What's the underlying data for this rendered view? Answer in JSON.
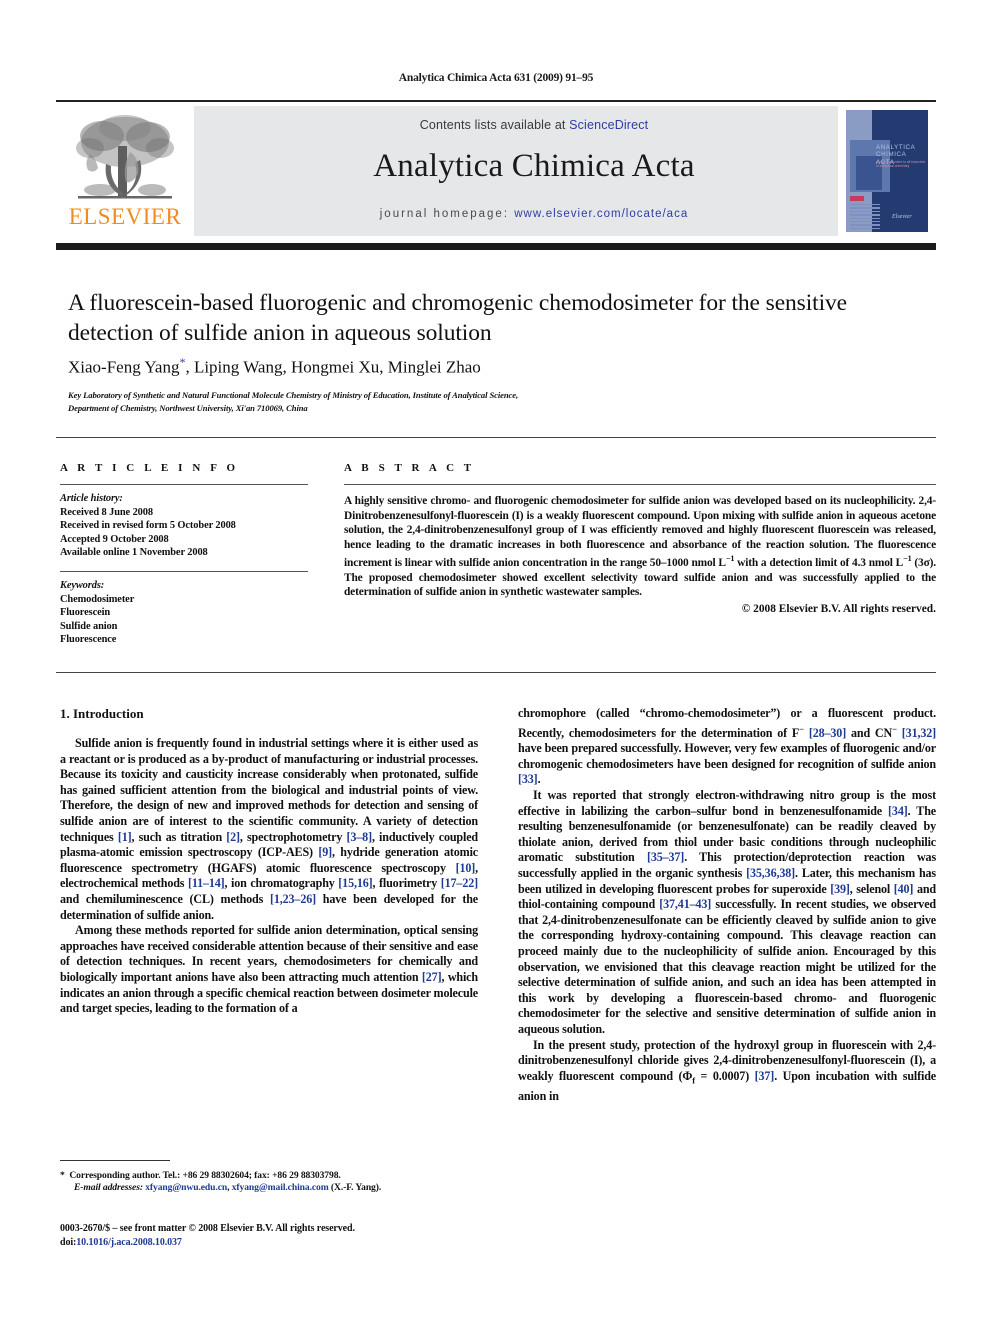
{
  "running_head": "Analytica Chimica Acta 631 (2009) 91–95",
  "masthead": {
    "contents_prefix": "Contents lists available at ",
    "contents_link": "ScienceDirect",
    "journal_title": "Analytica Chimica Acta",
    "homepage_prefix": "journal homepage:",
    "homepage_url": "www.elsevier.com/locate/aca",
    "publisher_logo_text": "ELSEVIER",
    "publisher_logo_color": "#F08C1E",
    "link_color": "#2F3E9E",
    "banner_bg": "#e6e7e9",
    "cover": {
      "title": "ANALYTICA CHIMICA ACTA",
      "subtitle": "A journal devoted to all branches of analytical chemistry",
      "imprint": "Elsevier",
      "bg_color": "#243B72"
    }
  },
  "article": {
    "title": "A fluorescein-based fluorogenic and chromogenic chemodosimeter for the sensitive detection of sulfide anion in aqueous solution",
    "authors": "Xiao-Feng Yang",
    "authors_rest": ", Liping Wang, Hongmei Xu, Minglei Zhao",
    "corresponding_marker": "*",
    "affiliation_line1": "Key Laboratory of Synthetic and Natural Functional Molecule Chemistry of Ministry of Education, Institute of Analytical Science,",
    "affiliation_line2": "Department of Chemistry, Northwest University, Xi'an 710069, China"
  },
  "article_info": {
    "heading": "A R T I C L E    I N F O",
    "history_label": "Article history:",
    "history": [
      "Received 8 June 2008",
      "Received in revised form 5 October 2008",
      "Accepted 9 October 2008",
      "Available online 1 November 2008"
    ],
    "keywords_label": "Keywords:",
    "keywords": [
      "Chemodosimeter",
      "Fluorescein",
      "Sulfide anion",
      "Fluorescence"
    ]
  },
  "abstract": {
    "heading": "A B S T R A C T",
    "part1": "A highly sensitive chromo- and fluorogenic chemodosimeter for sulfide anion was developed based on its nucleophilicity. 2,4-Dinitrobenzenesulfonyl-fluorescein (I) is a weakly fluorescent compound. Upon mixing with sulfide anion in aqueous acetone solution, the 2,4-dinitrobenzenesulfonyl group of I was efficiently removed and highly fluorescent fluorescein was released, hence leading to the dramatic increases in both fluorescence and absorbance of the reaction solution. The fluorescence increment is linear with sulfide anion concentration in the range 50–1000 nmol L",
    "exp1": "−1",
    "part2": " with a detection limit of 4.3 nmol L",
    "exp2": "−1",
    "part3": " (3σ). The proposed chemodosimeter showed excellent selectivity toward sulfide anion and was successfully applied to the determination of sulfide anion in synthetic wastewater samples.",
    "copyright": "© 2008 Elsevier B.V. All rights reserved."
  },
  "body": {
    "section1_heading": "1.  Introduction",
    "left_p1_a": "Sulfide anion is frequently found in industrial settings where it is either used as a reactant or is produced as a by-product of manufacturing or industrial processes. Because its toxicity and causticity increase considerably when protonated, sulfide has gained sufficient attention from the biological and industrial points of view. Therefore, the design of new and improved methods for detection and sensing of sulfide anion are of interest to the scientific community. A variety of detection techniques ",
    "left_p1_r1": "[1]",
    "left_p1_b": ", such as titration ",
    "left_p1_r2": "[2]",
    "left_p1_c": ", spectrophotometry ",
    "left_p1_r3": "[3–8]",
    "left_p1_d": ", inductively coupled plasma-atomic emission spectroscopy (ICP-AES) ",
    "left_p1_r4": "[9]",
    "left_p1_e": ", hydride generation atomic fluorescence spectrometry (HGAFS) atomic fluorescence spectroscopy ",
    "left_p1_r5": "[10]",
    "left_p1_f": ", electrochemical methods ",
    "left_p1_r6": "[11–14]",
    "left_p1_g": ", ion chromatography ",
    "left_p1_r7": "[15,16]",
    "left_p1_h": ", fluorimetry ",
    "left_p1_r8": "[17–22]",
    "left_p1_i": " and chemiluminescence (CL) methods ",
    "left_p1_r9": "[1,23–26]",
    "left_p1_j": " have been developed for the determination of sulfide anion.",
    "left_p2_a": "Among these methods reported for sulfide anion determination, optical sensing approaches have received considerable attention because of their sensitive and ease of detection techniques. In recent years, chemodosimeters for chemically and biologically important anions have also been attracting much attention ",
    "left_p2_r1": "[27]",
    "left_p2_b": ", which indicates an anion through a specific chemical reaction between dosimeter molecule and target species, leading to the formation of a",
    "right_p1_a": "chromophore (called “chromo-chemodosimeter”) or a fluorescent product. Recently, chemodosimeters for the determination of F",
    "right_p1_sup1": "−",
    "right_p1_r1": "[28–30]",
    "right_p1_b": " and CN",
    "right_p1_sup2": "−",
    "right_p1_r2": "[31,32]",
    "right_p1_c": " have been prepared successfully. However, very few examples of fluorogenic and/or chromogenic chemodosimeters have been designed for recognition of sulfide anion ",
    "right_p1_r3": "[33]",
    "right_p1_d": ".",
    "right_p2_a": "It was reported that strongly electron-withdrawing nitro group is the most effective in labilizing the carbon–sulfur bond in benzenesulfonamide ",
    "right_p2_r1": "[34]",
    "right_p2_b": ". The resulting benzenesulfonamide (or benzenesulfonate) can be readily cleaved by thiolate anion, derived from thiol under basic conditions through nucleophilic aromatic substitution ",
    "right_p2_r2": "[35–37]",
    "right_p2_c": ". This protection/deprotection reaction was successfully applied in the organic synthesis ",
    "right_p2_r3": "[35,36,38]",
    "right_p2_d": ". Later, this mechanism has been utilized in developing fluorescent probes for superoxide ",
    "right_p2_r4": "[39]",
    "right_p2_e": ", selenol ",
    "right_p2_r5": "[40]",
    "right_p2_f": " and thiol-containing compound ",
    "right_p2_r6": "[37,41–43]",
    "right_p2_g": " successfully. In recent studies, we observed that 2,4-dinitrobenzenesulfonate can be efficiently cleaved by sulfide anion to give the corresponding hydroxy-containing compound. This cleavage reaction can proceed mainly due to the nucleophilicity of sulfide anion. Encouraged by this observation, we envisioned that this cleavage reaction might be utilized for the selective determination of sulfide anion, and such an idea has been attempted in this work by developing a fluorescein-based chromo- and fluorogenic chemodosimeter for the selective and sensitive determination of sulfide anion in aqueous solution.",
    "right_p3_a": "In the present study, protection of the hydroxyl group in fluorescein with 2,4-dinitrobenzenesulfonyl chloride gives 2,4-dinitrobenzenesulfonyl-fluorescein (I), a weakly fluorescent compound (Φ",
    "right_p3_sub": "f",
    "right_p3_b": " = 0.0007) ",
    "right_p3_r1": "[37]",
    "right_p3_c": ". Upon incubation with sulfide anion in"
  },
  "footnote": {
    "marker": "*",
    "line1": "Corresponding author. Tel.: +86 29 88302604; fax: +86 29 88303798.",
    "email_label": "E-mail addresses:",
    "email1": "xfyang@nwu.edu.cn",
    "email_sep": ", ",
    "email2": "xfyang@mail.china.com",
    "email_owner": " (X.-F. Yang).",
    "imprint_line": "0003-2670/$ – see front matter © 2008 Elsevier B.V. All rights reserved.",
    "doi_label": "doi:",
    "doi": "10.1016/j.aca.2008.10.037"
  }
}
